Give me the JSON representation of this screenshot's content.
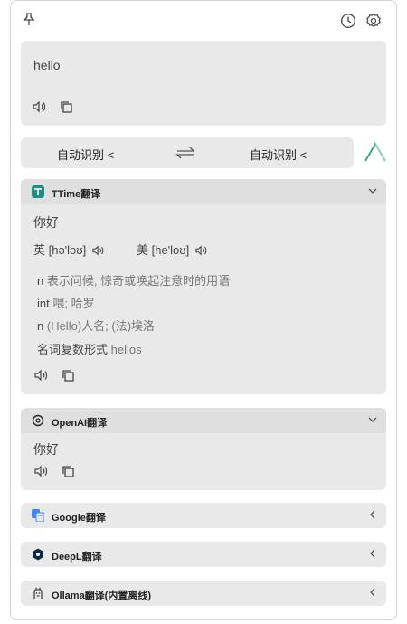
{
  "colors": {
    "panel": "#e9e9e9",
    "header": "#dfdfdf",
    "text": "#333333",
    "muted": "#777777",
    "accent_green": "#2ea37a",
    "accent_teal": "#1f8f86"
  },
  "icons": {
    "pin": "pin-icon",
    "history": "clock-icon",
    "settings": "gear-icon",
    "speaker": "speaker-icon",
    "copy": "copy-icon",
    "swap": "swap-arrows-icon",
    "chevron_down": "chevron-down-icon",
    "chevron_left": "chevron-left-icon"
  },
  "input": {
    "text": "hello"
  },
  "language_bar": {
    "source": "自动识别  <",
    "target": "自动识别  <"
  },
  "services": [
    {
      "name": "TTime翻译",
      "expanded": true,
      "main": "你好",
      "phonetic_uk": "英 [hə'ləʊ]",
      "phonetic_us": "美 [he'loʊ]",
      "definitions": [
        {
          "pos": "n",
          "text": "表示问候,  惊奇或唤起注意时的用语"
        },
        {
          "pos": "int",
          "text": "喂; 哈罗"
        },
        {
          "pos": "n",
          "text": "(Hello)人名; (法)埃洛"
        }
      ],
      "plural_label": "名词复数形式",
      "plural_value": "hellos"
    },
    {
      "name": "OpenAI翻译",
      "expanded": true,
      "main": "你好"
    },
    {
      "name": "Google翻译",
      "expanded": false
    },
    {
      "name": "DeepL翻译",
      "expanded": false
    },
    {
      "name": "Ollama翻译(内置离线)",
      "expanded": false
    }
  ]
}
